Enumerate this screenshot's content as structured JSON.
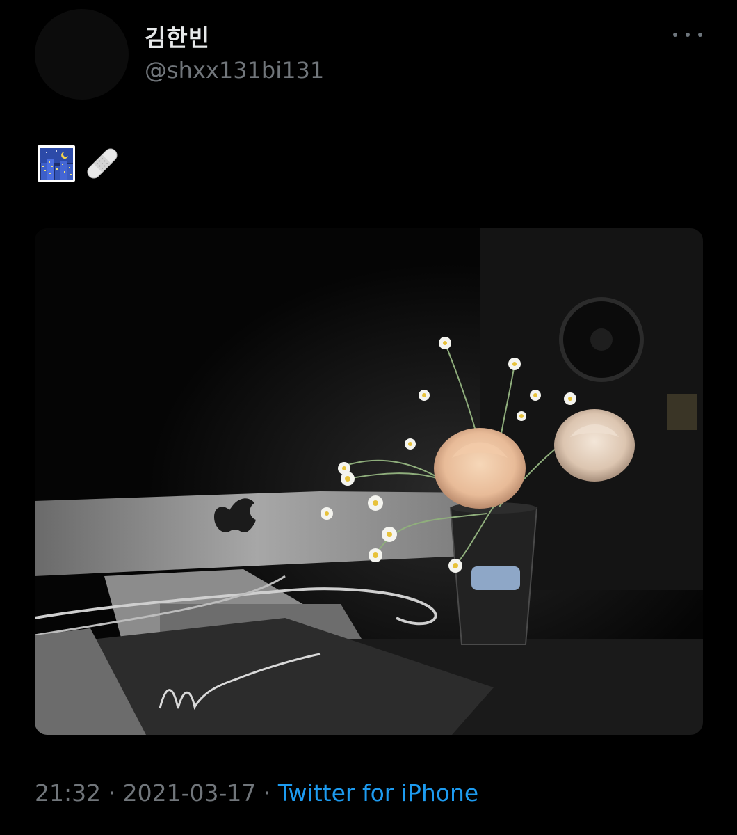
{
  "user": {
    "display_name": "김한빈",
    "handle": "@shxx131bi131"
  },
  "tweet": {
    "emojis": [
      "night-city-emoji",
      "bandage-emoji"
    ]
  },
  "meta": {
    "time": "21:32",
    "separator": " · ",
    "date": "2021-03-17",
    "source": "Twitter for iPhone"
  },
  "colors": {
    "background": "#000000",
    "name": "#e7e9ea",
    "secondary": "#71767b",
    "link": "#1d9bf0"
  }
}
